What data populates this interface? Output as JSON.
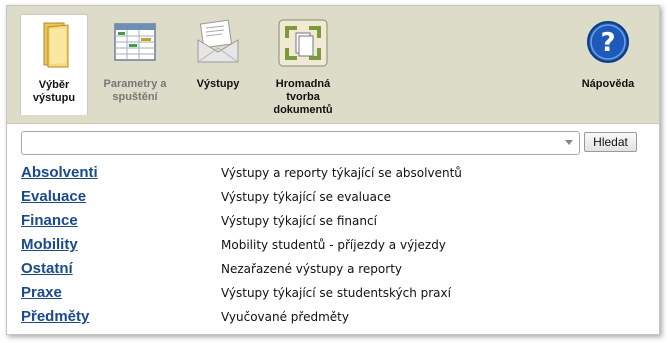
{
  "toolbar": {
    "tools": [
      {
        "label": "Výběr výstupu",
        "icon": "folder-icon",
        "state": "active"
      },
      {
        "label": "Parametry a spuštění",
        "icon": "spreadsheet-icon",
        "state": "disabled"
      },
      {
        "label": "Výstupy",
        "icon": "envelope-icon",
        "state": "normal"
      },
      {
        "label": "Hromadná tvorba dokumentů",
        "icon": "batch-documents-icon",
        "state": "normal"
      },
      {
        "label": "Nápověda",
        "icon": "help-icon",
        "state": "normal"
      }
    ]
  },
  "search": {
    "value": "",
    "button_label": "Hledat"
  },
  "categories": [
    {
      "name": "Absolventi",
      "description": "Výstupy a reporty týkající se absolventů"
    },
    {
      "name": "Evaluace",
      "description": "Výstupy týkající se evaluace"
    },
    {
      "name": "Finance",
      "description": "Výstupy týkající se financí"
    },
    {
      "name": "Mobility",
      "description": "Mobility studentů - příjezdy a výjezdy"
    },
    {
      "name": "Ostatní",
      "description": "Nezařazené výstupy a reporty"
    },
    {
      "name": "Praxe",
      "description": "Výstupy týkající se studentských praxí"
    },
    {
      "name": "Předměty",
      "description": "Vyučované předměty"
    }
  ],
  "colors": {
    "toolbar_bg": "#dcdcc8",
    "link": "#1a4a8c",
    "help_blue": "#1e5bb8"
  }
}
